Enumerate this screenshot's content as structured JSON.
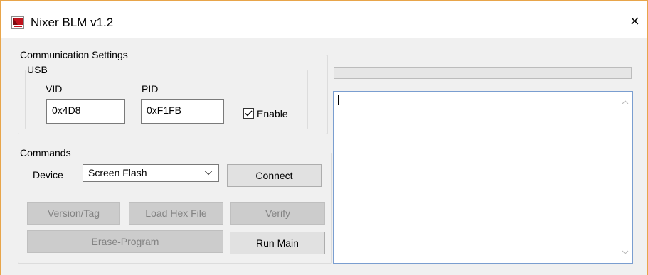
{
  "window": {
    "title": "Nixer BLM v1.2",
    "icon": "nixer-logo-icon",
    "close_glyph": "×"
  },
  "communication": {
    "legend": "Communication Settings",
    "usb": {
      "legend": "USB",
      "vid_label": "VID",
      "pid_label": "PID",
      "vid_value": "0x4D8",
      "pid_value": "0xF1FB",
      "enable_label": "Enable",
      "enable_checked": true
    }
  },
  "commands": {
    "legend": "Commands",
    "device_label": "Device",
    "device_selected": "Screen Flash",
    "connect_label": "Connect",
    "version_tag_label": "Version/Tag",
    "load_hex_label": "Load Hex File",
    "verify_label": "Verify",
    "erase_program_label": "Erase-Program",
    "run_main_label": "Run Main"
  },
  "progress": {
    "value": 0
  },
  "log": {
    "text": ""
  },
  "colors": {
    "window_border": "#e8a54a",
    "log_border": "#7a9ed0",
    "button_bg": "#e1e1e1",
    "button_disabled_bg": "#cccccc",
    "button_disabled_text": "#838383"
  }
}
